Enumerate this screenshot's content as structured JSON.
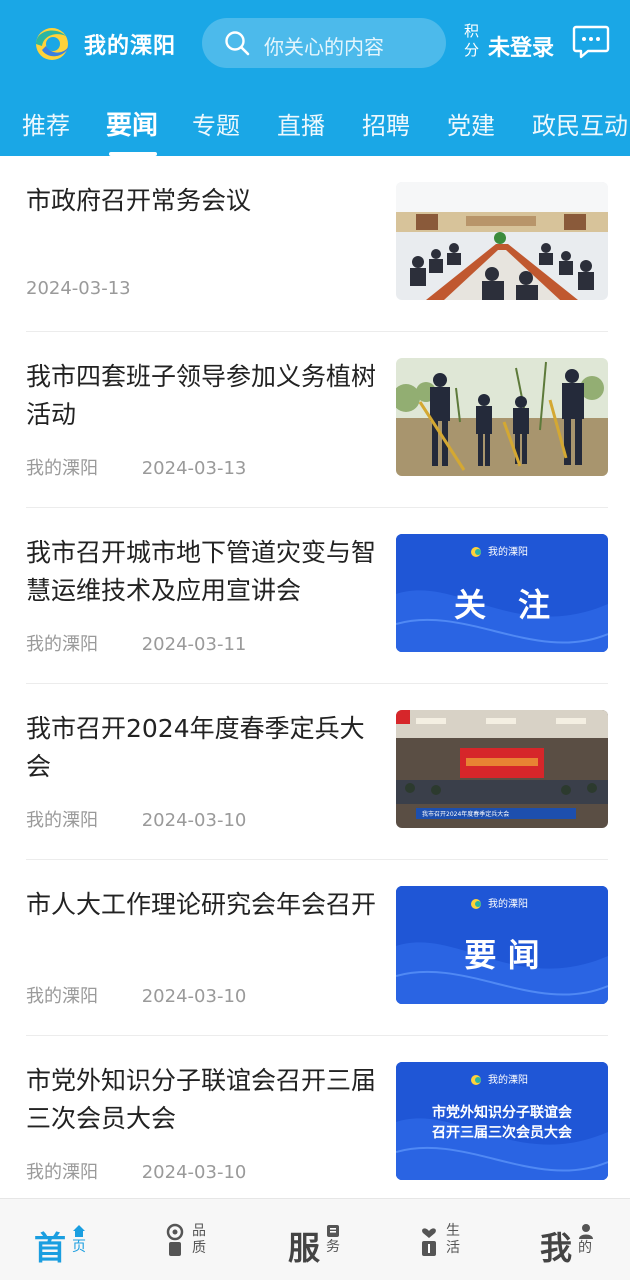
{
  "header": {
    "app_title": "我的溧阳",
    "search_placeholder": "你关心的内容",
    "points_label": "积分",
    "login_label": "未登录"
  },
  "tabs": [
    {
      "label": "推荐"
    },
    {
      "label": "要闻",
      "active": true
    },
    {
      "label": "专题"
    },
    {
      "label": "直播"
    },
    {
      "label": "招聘"
    },
    {
      "label": "党建"
    },
    {
      "label": "政民互动"
    }
  ],
  "news": [
    {
      "title": "市政府召开常务会议",
      "source": "",
      "date": "2024-03-13",
      "thumb": "meeting-photo"
    },
    {
      "title": "我市四套班子领导参加义务植树活动",
      "source": "我的溧阳",
      "date": "2024-03-13",
      "thumb": "tree-planting-photo"
    },
    {
      "title": "我市召开城市地下管道灾变与智慧运维技术及应用宣讲会",
      "source": "我的溧阳",
      "date": "2024-03-11",
      "thumb": "banner-guanzhu",
      "thumb_brand": "我的溧阳",
      "thumb_text": "关　注"
    },
    {
      "title": "我市召开2024年度春季定兵大会",
      "source": "我的溧阳",
      "date": "2024-03-10",
      "thumb": "conference-photo",
      "thumb_caption": "我市召开2024年度春季定兵大会"
    },
    {
      "title": "市人大工作理论研究会年会召开",
      "source": "我的溧阳",
      "date": "2024-03-10",
      "thumb": "banner-yaowen",
      "thumb_brand": "我的溧阳",
      "thumb_text": "要 闻"
    },
    {
      "title": "市党外知识分子联谊会召开三届三次会员大会",
      "source": "我的溧阳",
      "date": "2024-03-10",
      "thumb": "banner-text",
      "thumb_brand": "我的溧阳",
      "thumb_text_line1": "市党外知识分子联谊会",
      "thumb_text_line2": "召开三届三次会员大会"
    }
  ],
  "bottom_nav": [
    {
      "big": "首",
      "small": "页",
      "icon": "home-icon",
      "active": true
    },
    {
      "big": "",
      "small": "品质",
      "icon": "quality-icon"
    },
    {
      "big": "服",
      "small": "务",
      "icon": "service-icon"
    },
    {
      "big": "",
      "small": "生活",
      "icon": "life-icon"
    },
    {
      "big": "我",
      "small": "的",
      "icon": "user-icon"
    }
  ],
  "colors": {
    "brand": "#1aa7e6",
    "nav_active": "#1a9ee0",
    "banner_blue": "#1f56d6"
  }
}
